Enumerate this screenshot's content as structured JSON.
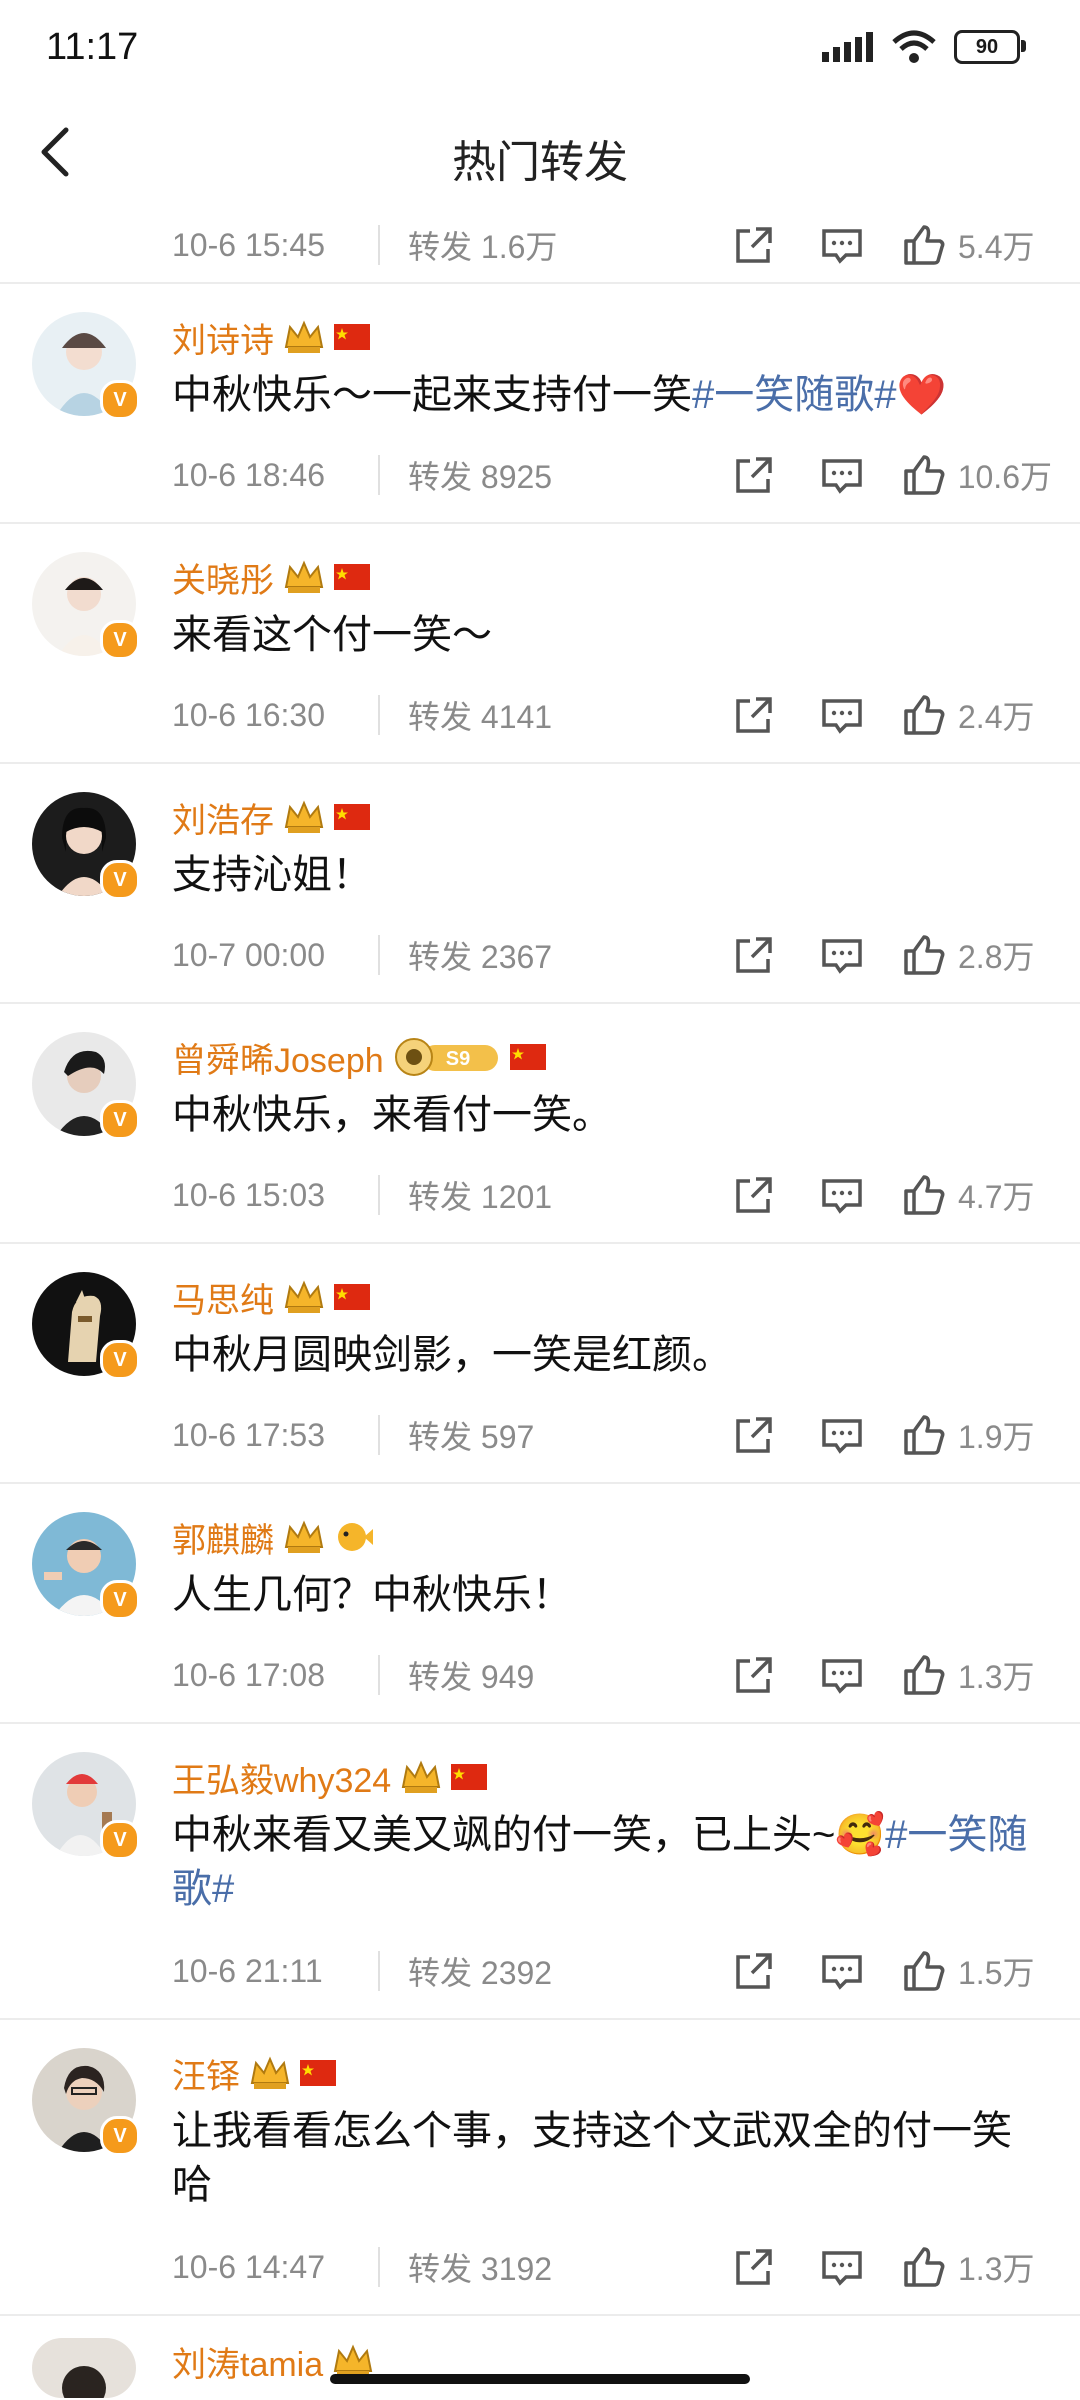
{
  "status_bar": {
    "time": "11:17",
    "battery": "90"
  },
  "nav": {
    "title": "热门转发"
  },
  "first_row": {
    "time": "10-6 15:45",
    "repost": "转发 1.6万",
    "likes": "5.4万"
  },
  "posts": [
    {
      "name": "刘诗诗",
      "text": "中秋快乐～一起来支持付一笑",
      "hashtag": "#一笑随歌#",
      "emoji": "❤️",
      "time": "10-6 18:46",
      "repost": "转发 8925",
      "likes": "10.6万",
      "badge": "crown"
    },
    {
      "name": "关晓彤",
      "text": "来看这个付一笑～",
      "hashtag": "",
      "emoji": "",
      "time": "10-6 16:30",
      "repost": "转发 4141",
      "likes": "2.4万",
      "badge": "crown"
    },
    {
      "name": "刘浩存",
      "text": "支持沁姐！",
      "hashtag": "",
      "emoji": "",
      "time": "10-7 00:00",
      "repost": "转发 2367",
      "likes": "2.8万",
      "badge": "crown"
    },
    {
      "name": "曾舜晞Joseph",
      "text": "中秋快乐，来看付一笑。",
      "hashtag": "",
      "emoji": "",
      "time": "10-6 15:03",
      "repost": "转发 1201",
      "likes": "4.7万",
      "badge": "s9",
      "badge_text": "S9"
    },
    {
      "name": "马思纯",
      "text": "中秋月圆映剑影，一笑是红颜。",
      "hashtag": "",
      "emoji": "",
      "time": "10-6 17:53",
      "repost": "转发 597",
      "likes": "1.9万",
      "badge": "crown"
    },
    {
      "name": "郭麒麟",
      "text": "人生几何？中秋快乐！",
      "hashtag": "",
      "emoji": "",
      "time": "10-6 17:08",
      "repost": "转发 949",
      "likes": "1.3万",
      "badge": "crown"
    },
    {
      "name": "王弘毅why324",
      "text": "中秋来看又美又飒的付一笑，已上头~",
      "hashtag": "#一笑随歌#",
      "emoji": "🥰",
      "time": "10-6 21:11",
      "repost": "转发 2392",
      "likes": "1.5万",
      "badge": "crown"
    },
    {
      "name": "汪铎",
      "text": "让我看看怎么个事，支持这个文武双全的付一笑哈",
      "hashtag": "",
      "emoji": "",
      "time": "10-6 14:47",
      "repost": "转发 3192",
      "likes": "1.3万",
      "badge": "crown"
    }
  ],
  "partial_post": {
    "name": "刘涛tamia"
  },
  "colors": {
    "name": "#e07a16",
    "hashtag": "#4a6ea9",
    "meta": "#8a8a8a",
    "verified": "#f59a1b"
  }
}
